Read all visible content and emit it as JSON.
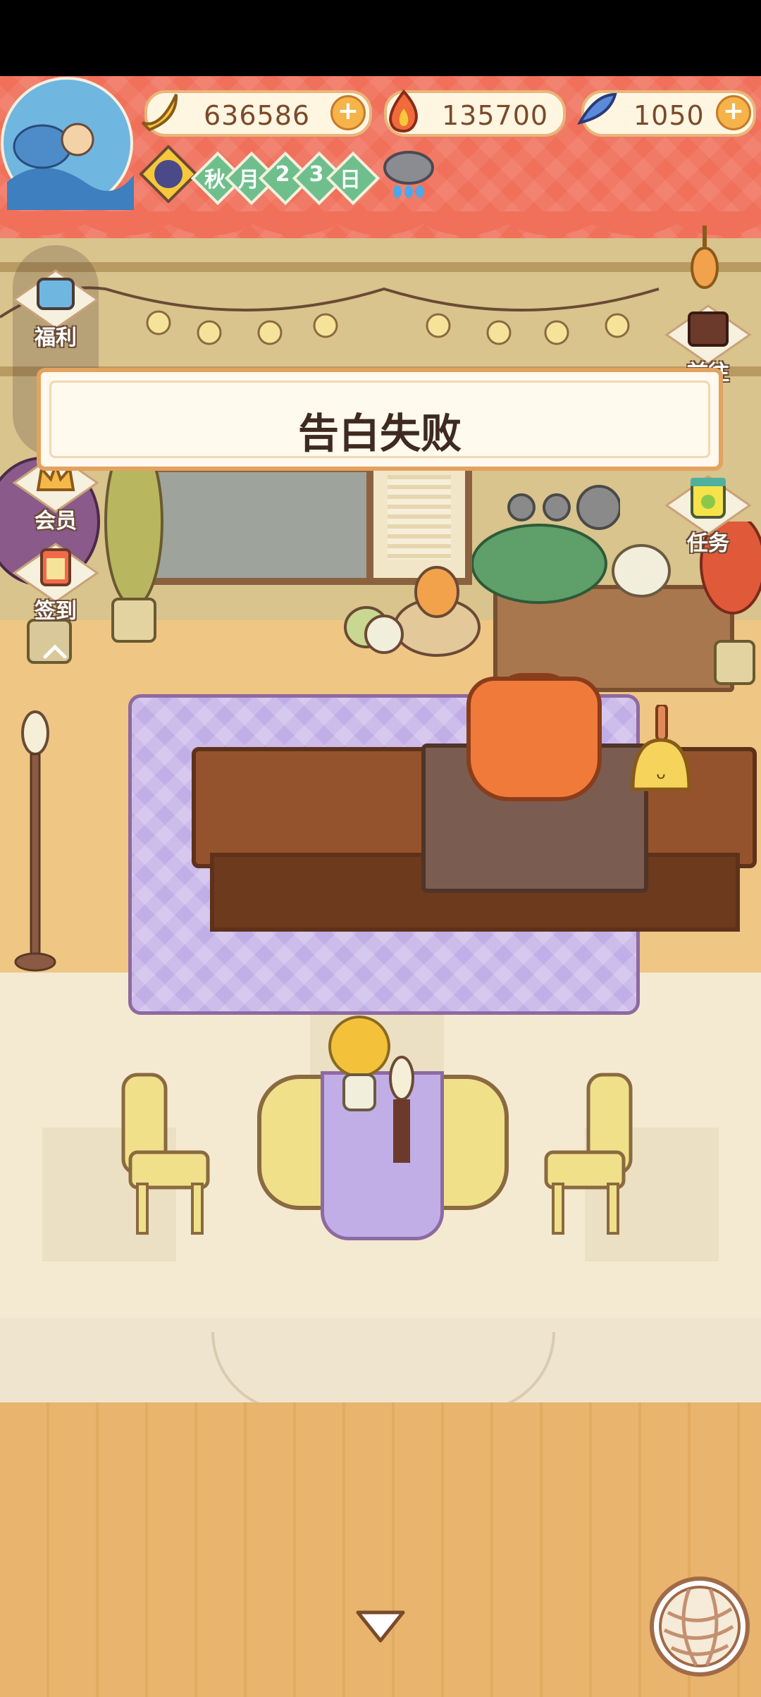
{
  "currencies": {
    "banana": {
      "value": "636586",
      "icon": "banana-icon"
    },
    "flame": {
      "value": "135700",
      "icon": "flame-icon"
    },
    "fish": {
      "value": "1050",
      "icon": "fish-icon"
    }
  },
  "date": {
    "chars": [
      "秋",
      "月",
      "2",
      "3",
      "日"
    ],
    "weather_icon": "rain-cloud-icon"
  },
  "side_menu_left": [
    {
      "label": "福利",
      "icon": "tv-icon"
    },
    {
      "label": "会员",
      "icon": "crown-icon"
    },
    {
      "label": "签到",
      "icon": "calendar-icon"
    }
  ],
  "side_menu_right": [
    {
      "label": "前往",
      "icon": "board-icon"
    },
    {
      "label": "任务",
      "icon": "task-jar-icon"
    }
  ],
  "popup": {
    "message": "告白失败"
  },
  "colors": {
    "awning": "#f0705a",
    "popup_border": "#e3a25f",
    "date_green": "#6fbf8c"
  }
}
